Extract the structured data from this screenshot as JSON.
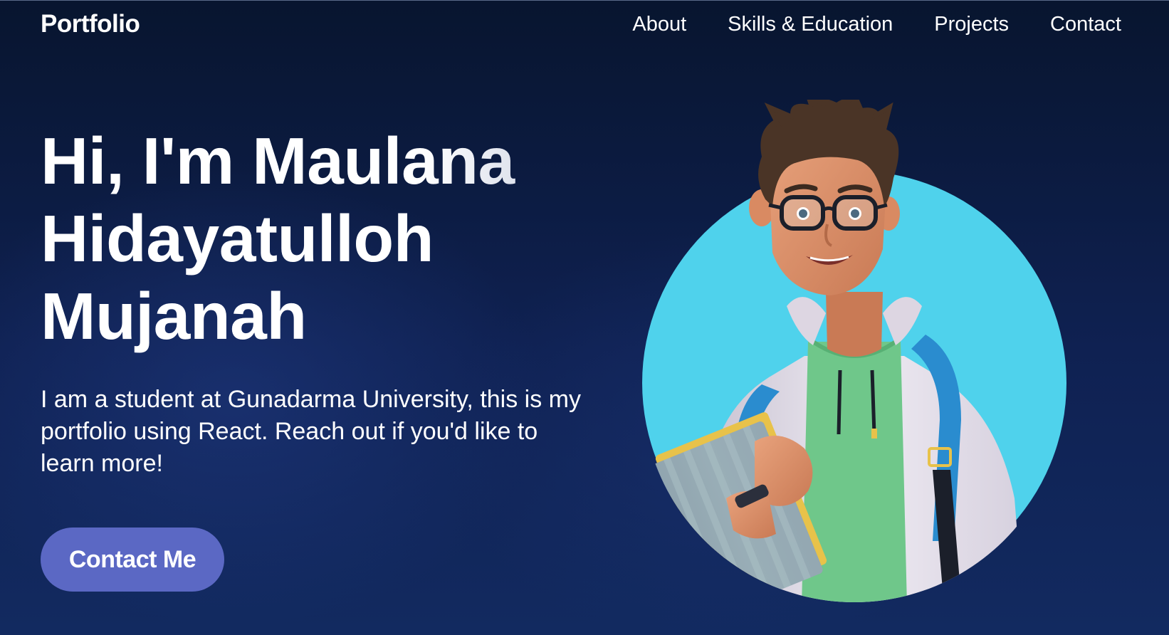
{
  "nav": {
    "brand": "Portfolio",
    "links": [
      "About",
      "Skills & Education",
      "Projects",
      "Contact"
    ]
  },
  "hero": {
    "title_lines": [
      "Hi, I'm Maulana",
      "Hidayatulloh",
      "Mujanah"
    ],
    "description": "I am a student at Gunadarma University, this is my portfolio using React. Reach out if you'd like to learn more!",
    "cta_label": "Contact Me"
  },
  "colors": {
    "background": "#0f2152",
    "button": "#5b68c4",
    "avatar_circle": "#4fd2ec"
  },
  "avatar": {
    "icon": "student-avatar-illustration"
  }
}
